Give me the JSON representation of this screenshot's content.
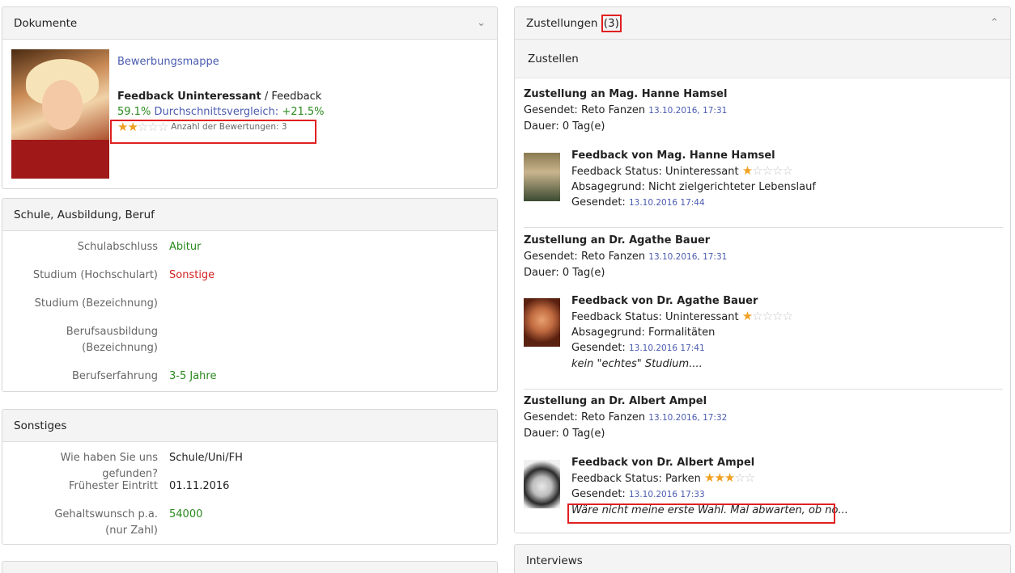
{
  "dokumente": {
    "title": "Dokumente",
    "link": "Bewerbungsmappe",
    "feedback_bold": "Feedback Uninteressant",
    "feedback_rest": " / Feedback",
    "percent": "59.1%",
    "compare_label": "Durchschnittsvergleich:",
    "compare_value": "+21.5%",
    "rating": 2,
    "rating_max": 5,
    "rating_count": "Anzahl der Bewertungen: 3"
  },
  "schule": {
    "title": "Schule, Ausbildung, Beruf",
    "rows": [
      {
        "label": "Schulabschluss",
        "value": "Abitur"
      },
      {
        "label": "Studium (Hochschulart)",
        "value": "Sonstige"
      },
      {
        "label": "Studium (Bezeichnung)",
        "value": ""
      },
      {
        "label": "Berufsausbildung (Bezeichnung)",
        "value": ""
      },
      {
        "label": "Berufserfahrung",
        "value": "3-5 Jahre"
      }
    ]
  },
  "sonstiges": {
    "title": "Sonstiges",
    "rows": [
      {
        "label": "Wie haben Sie uns gefunden?",
        "value": "Schule/Uni/FH"
      },
      {
        "label": "Frühester Eintritt",
        "value": "01.11.2016"
      },
      {
        "label": "Gehaltswunsch p.a. (nur Zahl)",
        "value": "54000"
      }
    ]
  },
  "zustellungen": {
    "title": "Zustellungen",
    "count": "(3)",
    "button": "Zustellen",
    "sent_label": "Gesendet:",
    "items": [
      {
        "title": "Zustellung an Mag. Hanne Hamsel",
        "sender": "Reto Fanzen",
        "date": "13.10.2016, 17:31",
        "duration": "Dauer: 0 Tag(e)",
        "fb_title": "Feedback von Mag. Hanne Hamsel",
        "fb_status": "Feedback Status: Uninteressant",
        "rating": 1,
        "reason": "Absagegrund: Nicht zielgerichteter Lebenslauf",
        "fb_date": "13.10.2016 17:44",
        "comment": ""
      },
      {
        "title": "Zustellung an Dr. Agathe Bauer",
        "sender": "Reto Fanzen",
        "date": "13.10.2016, 17:31",
        "duration": "Dauer: 0 Tag(e)",
        "fb_title": "Feedback von Dr. Agathe Bauer",
        "fb_status": "Feedback Status: Uninteressant",
        "rating": 1,
        "reason": "Absagegrund: Formalitäten",
        "fb_date": "13.10.2016 17:41",
        "comment": "kein \"echtes\" Studium...."
      },
      {
        "title": "Zustellung an Dr. Albert Ampel",
        "sender": "Reto Fanzen",
        "date": "13.10.2016, 17:32",
        "duration": "Dauer: 0 Tag(e)",
        "fb_title": "Feedback von Dr. Albert Ampel",
        "fb_status": "Feedback Status: Parken",
        "rating": 3,
        "reason": "",
        "fb_date": "13.10.2016 17:33",
        "comment": "Wäre nicht meine erste Wahl. Mal abwarten, ob no..."
      }
    ]
  },
  "interviews": {
    "title": "Interviews"
  },
  "colors": {
    "link": "#4a5bb0",
    "positive": "#2a8a1e",
    "negative": "#d42020",
    "star": "#f0a020",
    "highlight": "#e02020"
  },
  "icons": {
    "collapse": "chevron-double-down-icon",
    "expand": "chevron-double-up-icon",
    "star": "star-icon"
  }
}
